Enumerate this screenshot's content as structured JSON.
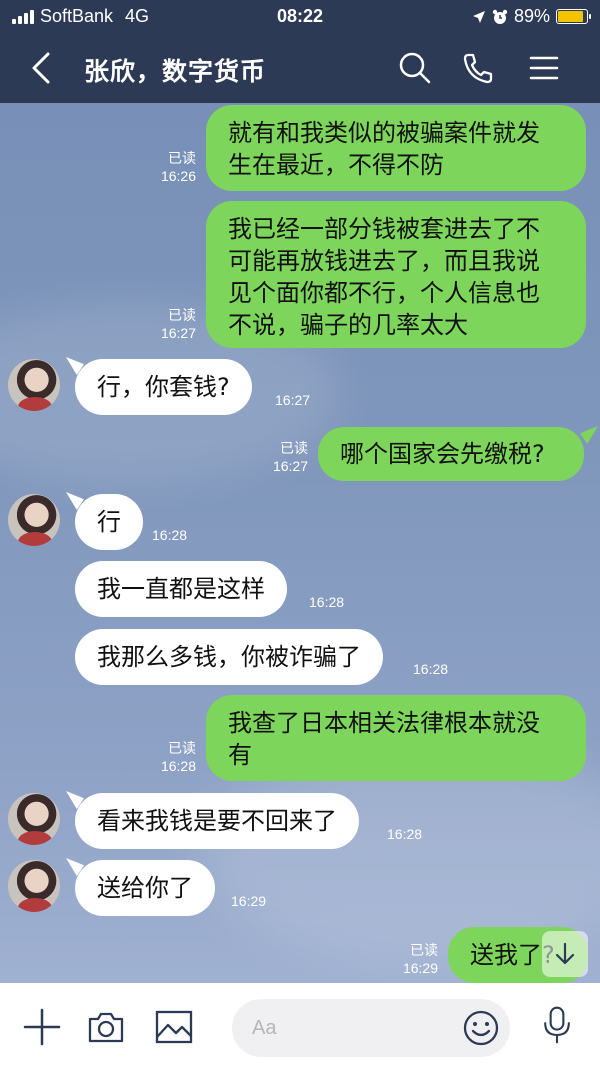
{
  "status_bar": {
    "carrier": "SoftBank",
    "network": "4G",
    "time": "08:22",
    "battery_percent": "89%",
    "battery_level": 0.89,
    "icons": [
      "signal-icon",
      "location-arrow-icon",
      "alarm-icon",
      "battery-icon"
    ]
  },
  "header": {
    "title": "张欣，数字货币",
    "icons": [
      "back-chevron-icon",
      "search-icon",
      "phone-icon",
      "menu-icon"
    ]
  },
  "messages": [
    {
      "side": "out",
      "lines": [
        "就有和我类似的被骗案件就发",
        "生在最近，不得不防"
      ],
      "read": "已读",
      "time": "16:26"
    },
    {
      "side": "out",
      "lines": [
        "我已经一部分钱被套进去了不",
        "可能再放钱进去了，而且我说",
        "见个面你都不行，个人信息也",
        "不说，骗子的几率太大"
      ],
      "read": "已读",
      "time": "16:27"
    },
    {
      "side": "in",
      "lines": [
        "行，你套钱?"
      ],
      "time": "16:27"
    },
    {
      "side": "out",
      "lines": [
        "哪个国家会先缴税?"
      ],
      "read": "已读",
      "time": "16:27"
    },
    {
      "side": "in",
      "lines": [
        "行"
      ],
      "time": "16:28"
    },
    {
      "side": "in",
      "lines": [
        "我一直都是这样"
      ],
      "time": "16:28"
    },
    {
      "side": "in",
      "lines": [
        "我那么多钱，你被诈骗了"
      ],
      "time": "16:28"
    },
    {
      "side": "out",
      "lines": [
        "我查了日本相关法律根本就没",
        "有"
      ],
      "read": "已读",
      "time": "16:28"
    },
    {
      "side": "in",
      "lines": [
        "看来我钱是要不回来了"
      ],
      "time": "16:28"
    },
    {
      "side": "in",
      "lines": [
        "送给你了"
      ],
      "time": "16:29"
    },
    {
      "side": "out",
      "lines": [
        "送我了?"
      ],
      "read": "已读",
      "time": "16:29"
    }
  ],
  "input_bar": {
    "placeholder": "Aa",
    "icons": [
      "plus-icon",
      "camera-icon",
      "image-icon",
      "emoji-icon",
      "microphone-icon"
    ]
  },
  "colors": {
    "header_bg": "#2c3a55",
    "outgoing_bubble": "#7ed55b",
    "incoming_bubble": "#ffffff",
    "battery": "#f5c400"
  }
}
